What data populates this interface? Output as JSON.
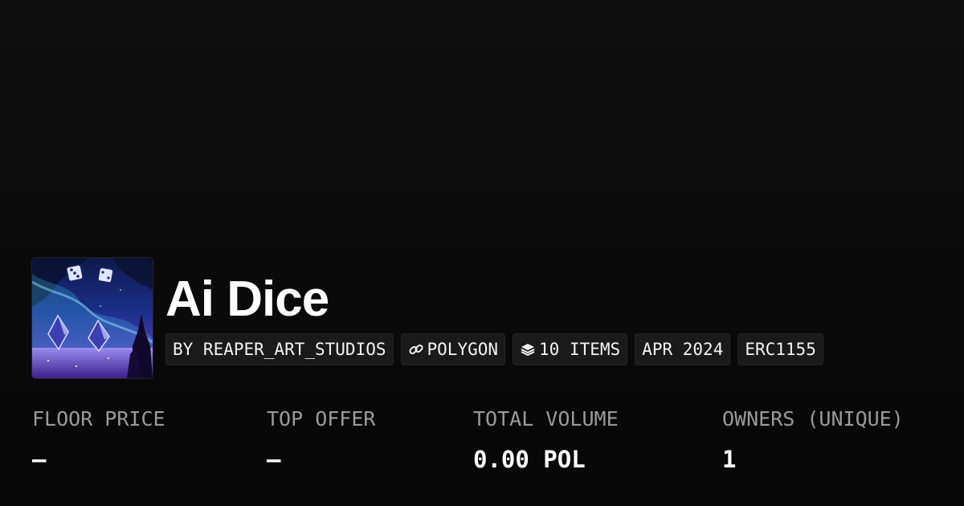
{
  "collection": {
    "name": "Ai Dice",
    "image": "ai-dice-collection-art"
  },
  "tags": {
    "creator": "BY REAPER_ART_STUDIOS",
    "chain": "POLYGON",
    "chain_icon": "link-icon",
    "items": "10 ITEMS",
    "items_icon": "layers-icon",
    "created": "APR 2024",
    "standard": "ERC1155"
  },
  "stats": {
    "floor_price": {
      "label": "FLOOR PRICE",
      "value": "–"
    },
    "top_offer": {
      "label": "TOP OFFER",
      "value": "–"
    },
    "total_volume": {
      "label": "TOTAL VOLUME",
      "value": "0.00 POL"
    },
    "owners": {
      "label": "OWNERS (UNIQUE)",
      "value": "1"
    }
  },
  "colors": {
    "background": "#0a0a0a",
    "tag_background": "#1a1a1a",
    "label": "#9a9a9a",
    "text": "#ffffff"
  }
}
